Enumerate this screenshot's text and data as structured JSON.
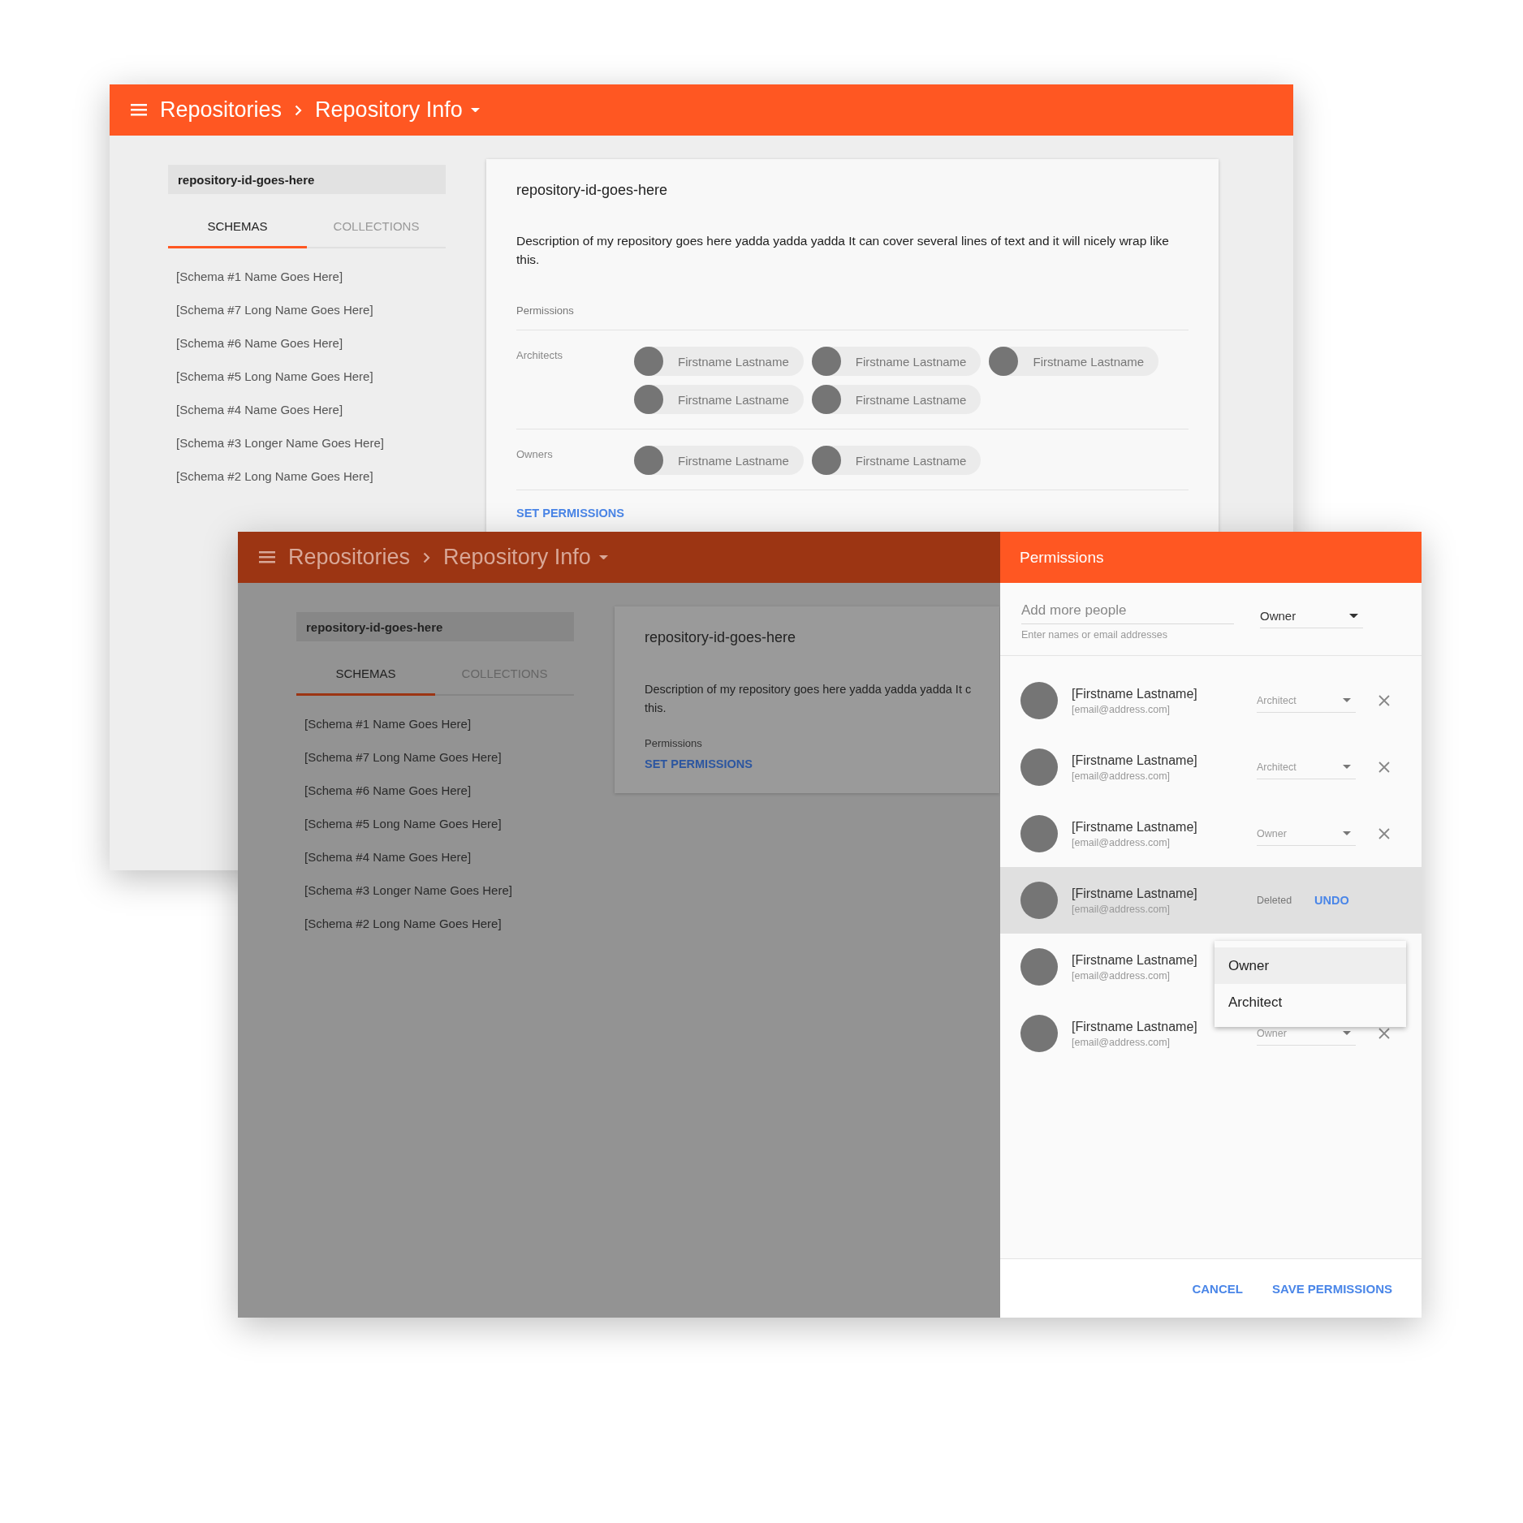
{
  "back_window": {
    "breadcrumb": {
      "parent": "Repositories",
      "current": "Repository Info"
    },
    "sidebar": {
      "repository_id": "repository-id-goes-here",
      "tabs": [
        {
          "label": "SCHEMAS",
          "selected": true
        },
        {
          "label": "COLLECTIONS",
          "selected": false
        }
      ],
      "schemas": [
        "[Schema #1 Name Goes Here]",
        "[Schema #7 Long Name Goes Here]",
        "[Schema #6 Name Goes Here]",
        "[Schema #5 Long Name Goes Here]",
        "[Schema #4 Name Goes Here]",
        "[Schema #3 Longer Name Goes Here]",
        "[Schema #2 Long Name Goes Here]"
      ]
    },
    "card": {
      "title": "repository-id-goes-here",
      "description": "Description of my repository goes here yadda yadda yadda It can cover several lines of text and it will nicely wrap like this.",
      "permissions_label": "Permissions",
      "groups": [
        {
          "label": "Architects",
          "members": [
            "Firstname Lastname",
            "Firstname Lastname",
            "Firstname Lastname",
            "Firstname Lastname",
            "Firstname Lastname"
          ]
        },
        {
          "label": "Owners",
          "members": [
            "Firstname Lastname",
            "Firstname Lastname"
          ]
        }
      ],
      "action": "SET PERMISSIONS"
    }
  },
  "front_window": {
    "breadcrumb": {
      "parent": "Repositories",
      "current": "Repository Info"
    },
    "sidebar": {
      "repository_id": "repository-id-goes-here",
      "tabs": [
        {
          "label": "SCHEMAS",
          "selected": true
        },
        {
          "label": "COLLECTIONS",
          "selected": false
        }
      ],
      "schemas": [
        "[Schema #1 Name Goes Here]",
        "[Schema #7 Long Name Goes Here]",
        "[Schema #6 Name Goes Here]",
        "[Schema #5 Long Name Goes Here]",
        "[Schema #4 Name Goes Here]",
        "[Schema #3 Longer Name Goes Here]",
        "[Schema #2 Long Name Goes Here]"
      ]
    },
    "card": {
      "title": "repository-id-goes-here",
      "description_lines": [
        "Description of my repository goes here yadda yadda yadda It c",
        "this."
      ],
      "permissions_label": "Permissions",
      "action": "SET PERMISSIONS"
    },
    "drawer": {
      "title": "Permissions",
      "add_field": {
        "placeholder": "Add more people",
        "helper": "Enter names or email addresses"
      },
      "role_select": "Owner",
      "people": [
        {
          "name": "[Firstname Lastname]",
          "email": "[email@address.com]",
          "role": "Architect",
          "deleted": false
        },
        {
          "name": "[Firstname Lastname]",
          "email": "[email@address.com]",
          "role": "Architect",
          "deleted": false
        },
        {
          "name": "[Firstname Lastname]",
          "email": "[email@address.com]",
          "role": "Owner",
          "deleted": false
        },
        {
          "name": "[Firstname Lastname]",
          "email": "[email@address.com]",
          "deleted": true,
          "status_text": "Deleted",
          "undo": "UNDO"
        },
        {
          "name": "[Firstname Lastname]",
          "email": "[email@address.com]",
          "deleted": false,
          "menu": [
            {
              "label": "Owner",
              "highlighted": true
            },
            {
              "label": "Architect",
              "highlighted": false
            }
          ]
        },
        {
          "name": "[Firstname Lastname]",
          "email": "[email@address.com]",
          "role": "Owner",
          "deleted": false
        }
      ],
      "buttons": [
        "CANCEL",
        "SAVE PERMISSIONS"
      ]
    }
  }
}
